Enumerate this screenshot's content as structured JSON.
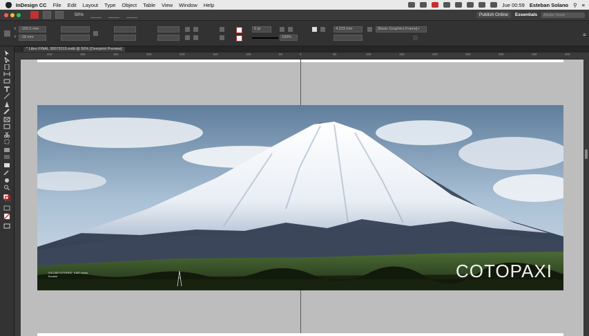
{
  "menubar": {
    "app_name": "InDesign CC",
    "menus": [
      "File",
      "Edit",
      "Layout",
      "Type",
      "Object",
      "Table",
      "View",
      "Window",
      "Help"
    ],
    "clock": "Jue 00:59",
    "user": "Esteban Solano"
  },
  "appbar": {
    "zoom": "50%",
    "publish_label": "Publish Online",
    "workspace": "Essentials",
    "search_placeholder": "Adobe Stock"
  },
  "control": {
    "x_value": "-155.5 mm",
    "y_value": "-18 mm",
    "stroke_weight": "0 pt",
    "scale_pct": "100%",
    "offset_value": "4.233 mm",
    "frame_style": "[Basic Graphics Frame]+"
  },
  "document": {
    "tab_title": "* Libro FINAL 30072015.indd @ 50% [Overprint Preview]",
    "ruler_labels": [
      "400",
      "350",
      "300",
      "250",
      "200",
      "150",
      "100",
      "50",
      "0",
      "50",
      "100",
      "150",
      "200",
      "250",
      "300",
      "350",
      "400"
    ]
  },
  "spread": {
    "title": "COTOPAXI",
    "caption_line1": "VOLCÁN COTOPAXI · 5.897 msnm",
    "caption_line2": "Ecuador"
  },
  "colors": {
    "canvas_bg": "#bdbdbd",
    "panel_bg": "#323232",
    "menubar_bg": "#e9e9e9",
    "accent_red": "#c53030"
  }
}
